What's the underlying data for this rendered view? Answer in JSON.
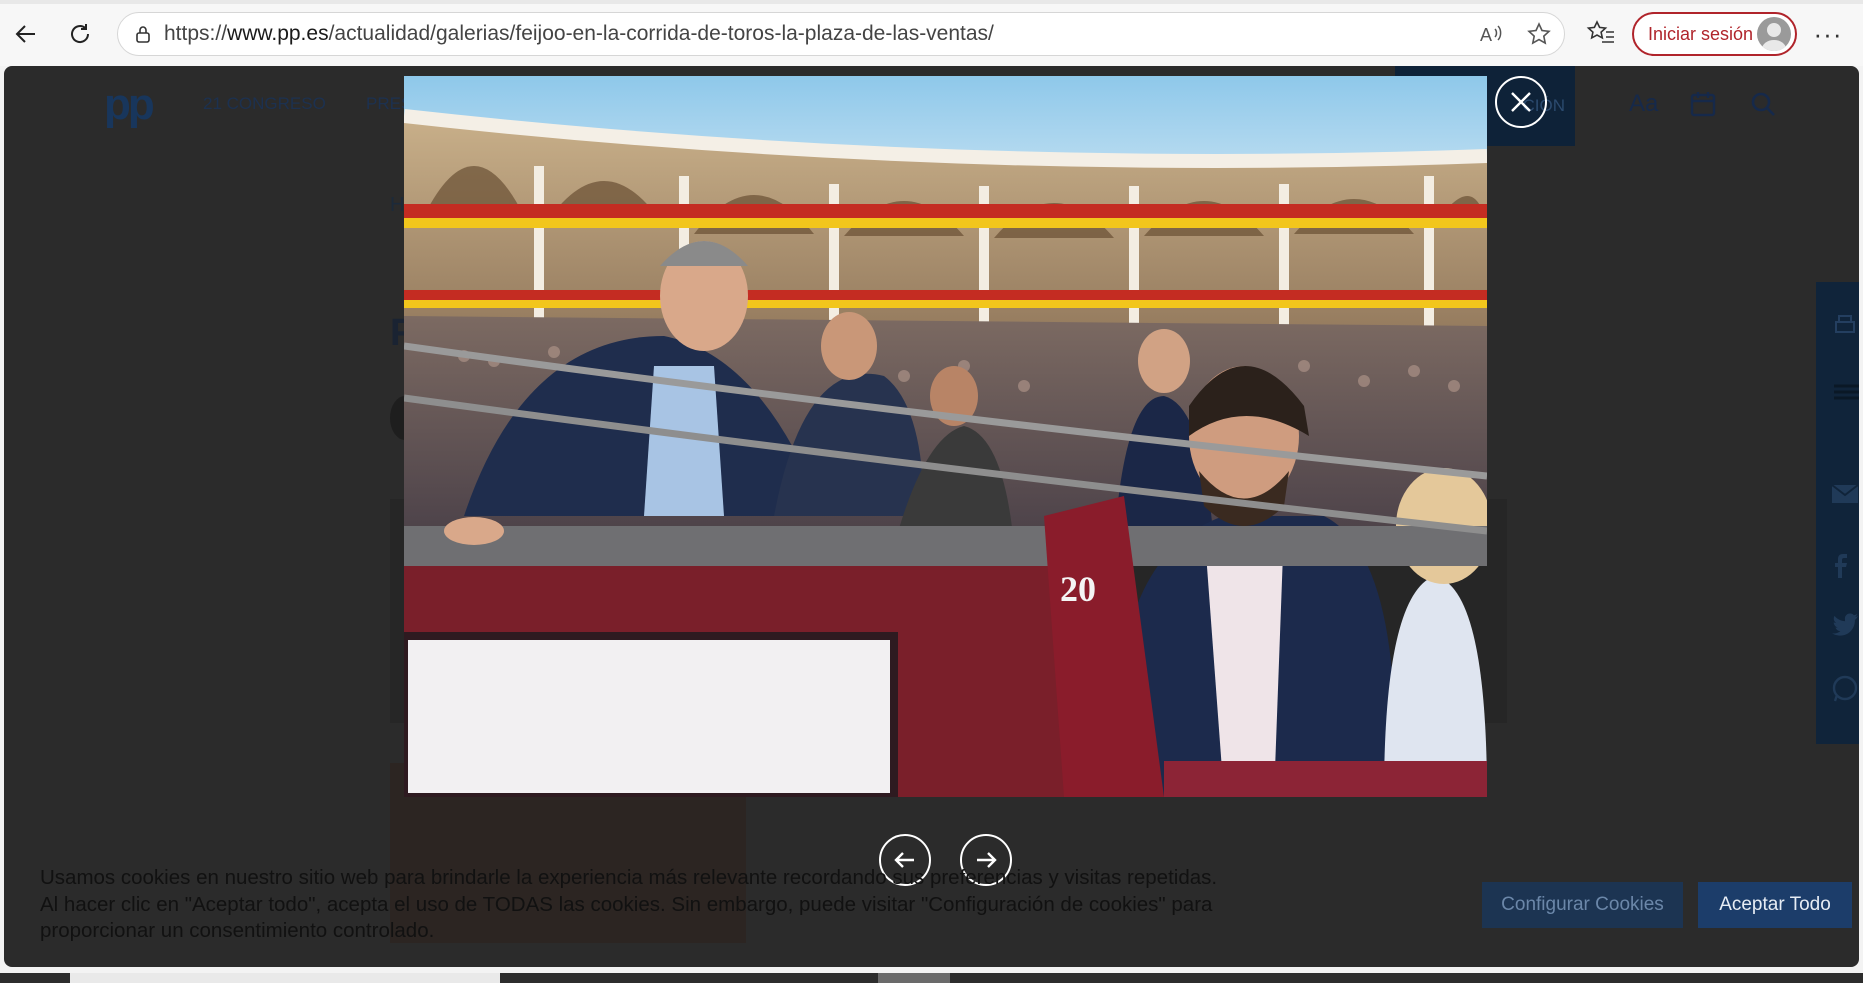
{
  "browser": {
    "url_prefix": "https://",
    "url_host": "www.pp.es",
    "url_path": "/actualidad/galerias/feijoo-en-la-corrida-de-toros-la-plaza-de-las-ventas/",
    "sign_in_label": "Iniciar sesión",
    "icons": [
      "back-icon",
      "refresh-icon",
      "lock-icon",
      "read-aloud-icon",
      "favorite-star-icon",
      "favorites-list-icon",
      "more-icon"
    ]
  },
  "site": {
    "logo_text": "pp",
    "nav": [
      "21 CONGRESO",
      "PRES",
      "CIÓN"
    ],
    "tools": [
      "Aa"
    ],
    "breadcrumb_initial": "H",
    "heading_initial": "F"
  },
  "lightbox": {
    "image_alt": "Feijóo en la corrida de toros en la plaza de Las Ventas",
    "barrier_number": "20",
    "close_icon": "close-icon",
    "prev_icon": "arrow-left-icon",
    "next_icon": "arrow-right-icon"
  },
  "cookies": {
    "line1": "Usamos cookies en nuestro sitio web para brindarle la experiencia más relevante recordando sus preferencias y visitas repetidas.",
    "line2": "Al hacer clic en \"Aceptar todo\", acepta el uso de TODAS las cookies. Sin embargo, puede visitar \"Configuración de cookies\" para",
    "line3": "proporcionar un consentimiento controlado.",
    "configure_label": "Configurar Cookies",
    "accept_label": "Aceptar Todo"
  }
}
